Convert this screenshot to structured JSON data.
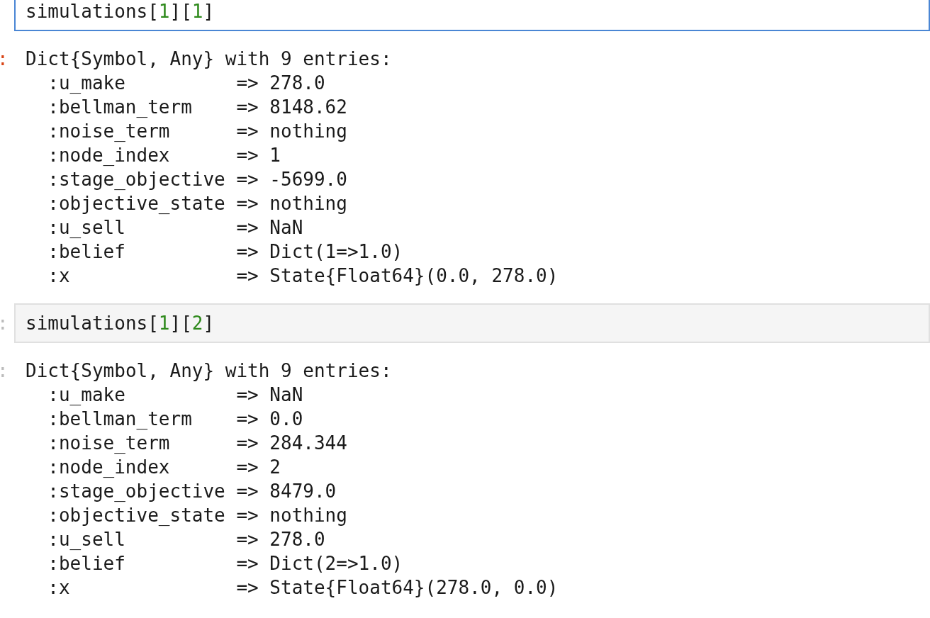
{
  "cells": [
    {
      "selected": true,
      "input": {
        "code": [
          {
            "kind": "name",
            "text": "simulations"
          },
          {
            "kind": "punct",
            "text": "["
          },
          {
            "kind": "number",
            "text": "1"
          },
          {
            "kind": "punct",
            "text": "]["
          },
          {
            "kind": "number",
            "text": "1"
          },
          {
            "kind": "punct",
            "text": "]"
          }
        ]
      },
      "output": {
        "prompt": ":",
        "header": "Dict{Symbol, Any} with 9 entries:",
        "entries": [
          {
            "key": ":u_make",
            "value": "=> 278.0"
          },
          {
            "key": ":bellman_term",
            "value": "=> 8148.62"
          },
          {
            "key": ":noise_term",
            "value": "=> nothing"
          },
          {
            "key": ":node_index",
            "value": "=> 1"
          },
          {
            "key": ":stage_objective",
            "value": "=> -5699.0"
          },
          {
            "key": ":objective_state",
            "value": "=> nothing"
          },
          {
            "key": ":u_sell",
            "value": "=> NaN"
          },
          {
            "key": ":belief",
            "value": "=> Dict(1=>1.0)"
          },
          {
            "key": ":x",
            "value": "=> State{Float64}(0.0, 278.0)"
          }
        ]
      }
    },
    {
      "selected": false,
      "input": {
        "prompt": ":",
        "code": [
          {
            "kind": "name",
            "text": "simulations"
          },
          {
            "kind": "punct",
            "text": "["
          },
          {
            "kind": "number",
            "text": "1"
          },
          {
            "kind": "punct",
            "text": "]["
          },
          {
            "kind": "number",
            "text": "2"
          },
          {
            "kind": "punct",
            "text": "]"
          }
        ]
      },
      "output": {
        "prompt": ":",
        "header": "Dict{Symbol, Any} with 9 entries:",
        "entries": [
          {
            "key": ":u_make",
            "value": "=> NaN"
          },
          {
            "key": ":bellman_term",
            "value": "=> 0.0"
          },
          {
            "key": ":noise_term",
            "value": "=> 284.344"
          },
          {
            "key": ":node_index",
            "value": "=> 2"
          },
          {
            "key": ":stage_objective",
            "value": "=> 8479.0"
          },
          {
            "key": ":objective_state",
            "value": "=> nothing"
          },
          {
            "key": ":u_sell",
            "value": "=> 278.0"
          },
          {
            "key": ":belief",
            "value": "=> Dict(2=>1.0)"
          },
          {
            "key": ":x",
            "value": "=> State{Float64}(278.0, 0.0)"
          }
        ]
      }
    }
  ]
}
